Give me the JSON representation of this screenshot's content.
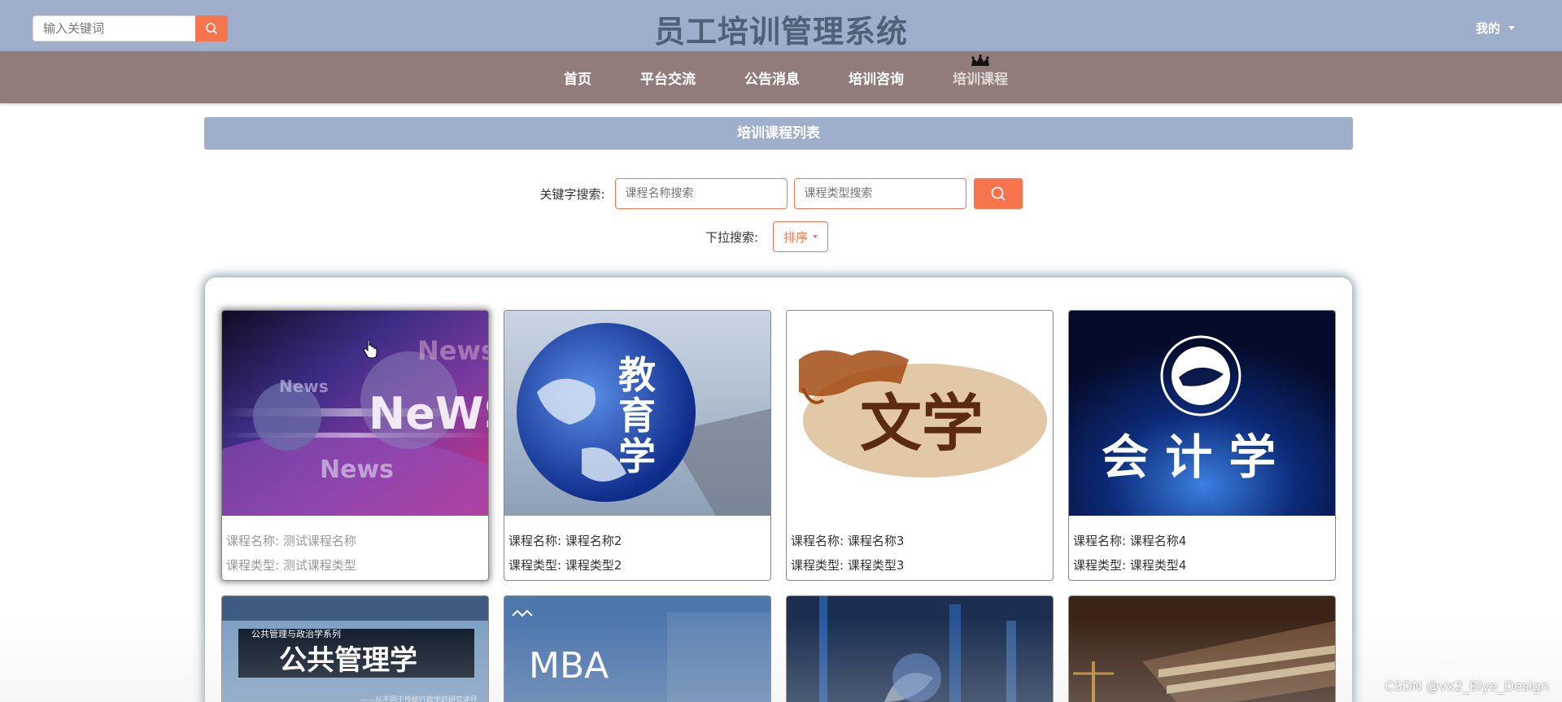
{
  "header": {
    "search_placeholder": "输入关键词",
    "site_title": "员工培训管理系统",
    "user_menu_label": "我的"
  },
  "nav": {
    "items": [
      {
        "label": "首页"
      },
      {
        "label": "平台交流"
      },
      {
        "label": "公告消息"
      },
      {
        "label": "培训咨询"
      },
      {
        "label": "培训课程",
        "active": true
      }
    ]
  },
  "list": {
    "banner_title": "培训课程列表",
    "keyword_label": "关键字搜索:",
    "name_placeholder": "课程名称搜索",
    "type_placeholder": "课程类型搜索",
    "dropdown_label": "下拉搜索:",
    "sort_label": "排序"
  },
  "courses": [
    {
      "name_label": "课程名称:",
      "name": "测试课程名称",
      "type_label": "课程类型:",
      "type": "测试课程类型",
      "image": "news"
    },
    {
      "name_label": "课程名称:",
      "name": "课程名称2",
      "type_label": "课程类型:",
      "type": "课程类型2",
      "image": "教育学"
    },
    {
      "name_label": "课程名称:",
      "name": "课程名称3",
      "type_label": "课程类型:",
      "type": "课程类型3",
      "image": "文学"
    },
    {
      "name_label": "课程名称:",
      "name": "课程名称4",
      "type_label": "课程类型:",
      "type": "课程类型4",
      "image": "会计学"
    }
  ],
  "courses_row2": [
    {
      "image": "公共管理学",
      "series_text": "公共管理与政治学系列",
      "title_text": "公共管理学",
      "subtitle_text": "——从不同于传统行政学的研究途径"
    },
    {
      "image": "MBA",
      "title_text": "MBA"
    },
    {
      "image": "finance"
    },
    {
      "image": "law"
    }
  ],
  "image_text": {
    "news_big": "NeWS",
    "news_small": "News",
    "edu": [
      "教",
      "育",
      "学"
    ],
    "lit": "文学",
    "acc": "会 计 学"
  },
  "watermark": "CSDN @vx2_Biye_Design",
  "colors": {
    "topbar": "#9fafcb",
    "navbar": "#917c7a",
    "accent": "#f7744d",
    "title": "#4f6079"
  }
}
